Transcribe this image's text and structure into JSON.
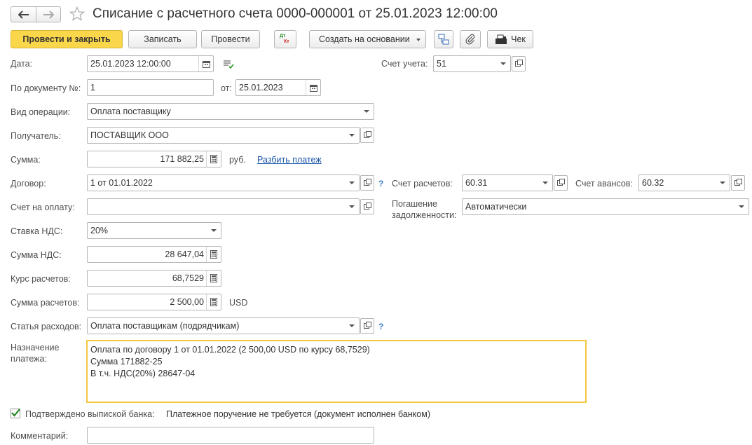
{
  "title": "Списание с расчетного счета 0000-000001 от 25.01.2023 12:00:00",
  "toolbar": {
    "post_close": "Провести и закрыть",
    "save": "Записать",
    "post": "Провести",
    "create_based": "Создать на основании",
    "receipt": "Чек",
    "dtkt_top": "Дт",
    "dtkt_bottom": "Кт"
  },
  "form": {
    "date_label": "Дата:",
    "date_value": "25.01.2023 12:00:00",
    "account_label": "Счет учета:",
    "account_value": "51",
    "doc_no_label": "По документу №:",
    "doc_no_value": "1",
    "doc_from_label": "от:",
    "doc_from_value": "25.01.2023",
    "operation_label": "Вид операции:",
    "operation_value": "Оплата поставщику",
    "recipient_label": "Получатель:",
    "recipient_value": "ПОСТАВЩИК ООО",
    "sum_label": "Сумма:",
    "sum_value": "171 882,25",
    "sum_currency": "руб.",
    "split_link": "Разбить платеж",
    "contract_label": "Договор:",
    "contract_value": "1 от 01.01.2022",
    "settle_acc_label": "Счет расчетов:",
    "settle_acc_value": "60.31",
    "advance_acc_label": "Счет авансов:",
    "advance_acc_value": "60.32",
    "invoice_label": "Счет на оплату:",
    "invoice_value": "",
    "debt_label_1": "Погашение",
    "debt_label_2": "задолженности:",
    "debt_value": "Автоматически",
    "vat_rate_label": "Ставка НДС:",
    "vat_rate_value": "20%",
    "vat_sum_label": "Сумма НДС:",
    "vat_sum_value": "28 647,04",
    "rate_label": "Курс расчетов:",
    "rate_value": "68,7529",
    "settle_sum_label": "Сумма расчетов:",
    "settle_sum_value": "2 500,00",
    "settle_currency": "USD",
    "expense_label": "Статья расходов:",
    "expense_value": "Оплата поставщикам (подрядчикам)",
    "purpose_label_1": "Назначение",
    "purpose_label_2": "платежа:",
    "purpose_line1": "Оплата по договору 1 от 01.01.2022 (2 500,00 USD по курсу 68,7529)",
    "purpose_line2": "Сумма 171882-25",
    "purpose_line3": "В т.ч. НДС(20%) 28647-04",
    "confirmed_label": "Подтверждено выпиской банка:",
    "confirmed_checked": true,
    "confirmed_note": "Платежное поручение не требуется (документ исполнен банком)",
    "comment_label": "Комментарий:",
    "comment_value": "",
    "help_mark": "?"
  }
}
